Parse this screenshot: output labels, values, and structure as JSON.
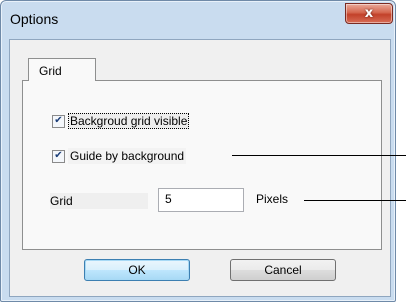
{
  "window": {
    "title": "Options",
    "close_glyph": "x"
  },
  "tabs": [
    {
      "label": "Grid"
    }
  ],
  "grid_panel": {
    "background_grid_visible": {
      "label": "Backgroud grid visible",
      "checked": true
    },
    "guide_by_background": {
      "label": "Guide by background",
      "checked": true
    },
    "grid_size": {
      "label": "Grid",
      "value": "5",
      "unit": "Pixels"
    }
  },
  "buttons": {
    "ok": "OK",
    "cancel": "Cancel"
  }
}
